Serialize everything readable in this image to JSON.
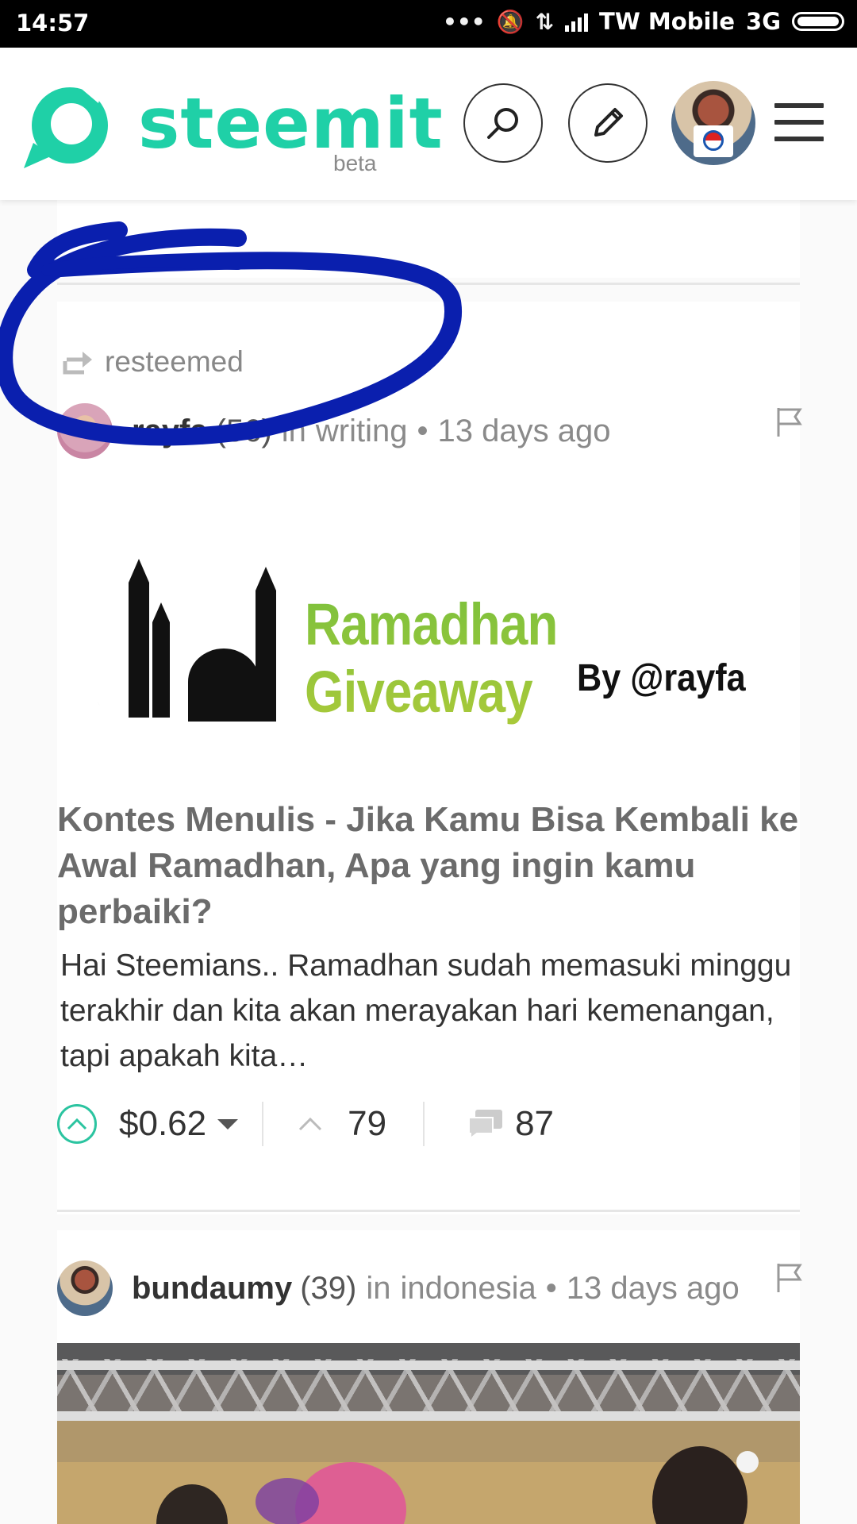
{
  "status_bar": {
    "time": "14:57",
    "carrier": "TW Mobile",
    "network": "3G"
  },
  "header": {
    "logo_text": "steemit",
    "beta_label": "beta",
    "brand_color": "#1fd0a7"
  },
  "feed": [
    {
      "resteemed_label": "resteemed",
      "author": "rayfa",
      "reputation": "(56)",
      "category_prefix": "in",
      "category": "writing",
      "time_sep": "•",
      "time_ago": "13 days ago",
      "thumbnail_title": "Ramadhan Giveaway",
      "thumbnail_subtitle": "By @rayfa",
      "title": "Kontes Menulis - Jika Kamu Bisa Kembali ke Awal Ramadhan, Apa yang ingin kamu perbaiki?",
      "body": "Hai Steemians.. Ramadhan sudah memasuki minggu terakhir dan kita akan merayakan hari kemenangan, tapi apakah kita…",
      "payout": "$0.62",
      "votes": "79",
      "comments": "87"
    },
    {
      "author": "bundaumy",
      "reputation": "(39)",
      "category_prefix": "in",
      "category": "indonesia",
      "time_sep": "•",
      "time_ago": "13 days ago"
    }
  ],
  "annotation_color": "#0a1fae"
}
